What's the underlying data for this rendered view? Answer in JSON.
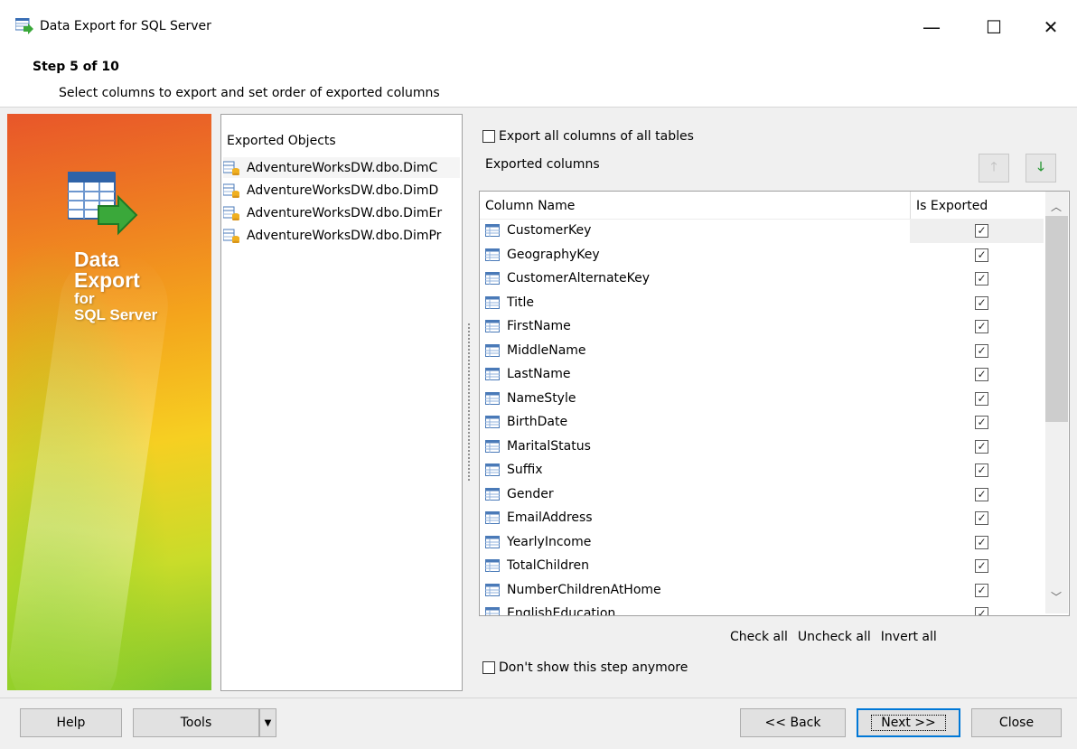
{
  "window": {
    "title": "Data Export for SQL Server",
    "minimize": "—",
    "maximize": "☐",
    "close": "✕"
  },
  "header": {
    "step": "Step 5 of 10",
    "description": "Select columns to export and set order of exported columns"
  },
  "banner": {
    "line1": "Data",
    "line2": "Export",
    "line3": "for",
    "line4": "SQL Server"
  },
  "objects": {
    "header": "Exported Objects",
    "items": [
      "AdventureWorksDW.dbo.DimC",
      "AdventureWorksDW.dbo.DimD",
      "AdventureWorksDW.dbo.DimEr",
      "AdventureWorksDW.dbo.DimPr"
    ]
  },
  "export_all": {
    "label": "Export all columns of all tables",
    "checked": false
  },
  "exported_columns_label": "Exported columns",
  "grid": {
    "headers": {
      "name": "Column Name",
      "exported": "Is Exported"
    },
    "rows": [
      {
        "name": "CustomerKey",
        "exported": true
      },
      {
        "name": "GeographyKey",
        "exported": true
      },
      {
        "name": "CustomerAlternateKey",
        "exported": true
      },
      {
        "name": "Title",
        "exported": true
      },
      {
        "name": "FirstName",
        "exported": true
      },
      {
        "name": "MiddleName",
        "exported": true
      },
      {
        "name": "LastName",
        "exported": true
      },
      {
        "name": "NameStyle",
        "exported": true
      },
      {
        "name": "BirthDate",
        "exported": true
      },
      {
        "name": "MaritalStatus",
        "exported": true
      },
      {
        "name": "Suffix",
        "exported": true
      },
      {
        "name": "Gender",
        "exported": true
      },
      {
        "name": "EmailAddress",
        "exported": true
      },
      {
        "name": "YearlyIncome",
        "exported": true
      },
      {
        "name": "TotalChildren",
        "exported": true
      },
      {
        "name": "NumberChildrenAtHome",
        "exported": true
      },
      {
        "name": "EnglishEducation",
        "exported": true
      }
    ]
  },
  "links": {
    "check_all": "Check all",
    "uncheck_all": "Uncheck all",
    "invert_all": "Invert all"
  },
  "dont_show": {
    "label": "Don't show this step anymore",
    "checked": false
  },
  "buttons": {
    "help": "Help",
    "tools": "Tools",
    "back": "<< Back",
    "next": "Next >>",
    "close": "Close"
  },
  "colors": {
    "accent": "#0078d7",
    "green_arrow": "#2e9a3a"
  }
}
